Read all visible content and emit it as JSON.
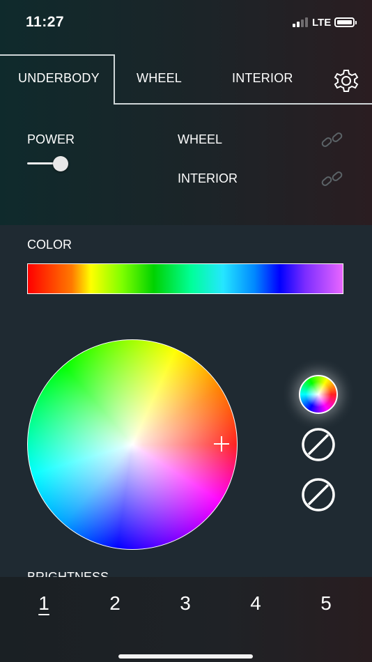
{
  "status_bar": {
    "time": "11:27",
    "network": "LTE",
    "signal_bars": 4,
    "signal_bars_active": 2,
    "battery_level": 0.85
  },
  "tabs": {
    "items": [
      "UNDERBODY",
      "WHEEL",
      "INTERIOR"
    ],
    "active": "UNDERBODY",
    "settings_icon": "gear-icon"
  },
  "power": {
    "label": "POWER",
    "value": 1.0
  },
  "links": [
    {
      "label": "WHEEL",
      "icon": "link-icon"
    },
    {
      "label": "INTERIOR",
      "icon": "link-icon"
    }
  ],
  "color": {
    "label": "COLOR"
  },
  "presets": [
    {
      "type": "color-wheel",
      "selected": true
    },
    {
      "type": "empty"
    },
    {
      "type": "empty"
    }
  ],
  "brightness": {
    "label": "BRIGHTNESS"
  },
  "bottom_nav": {
    "pages": [
      "1",
      "2",
      "3",
      "4",
      "5"
    ],
    "active": "1"
  },
  "colors": {
    "tab_border": "#cfd6d8",
    "panel_bg": "#1f2a32",
    "text": "#ffffff"
  }
}
